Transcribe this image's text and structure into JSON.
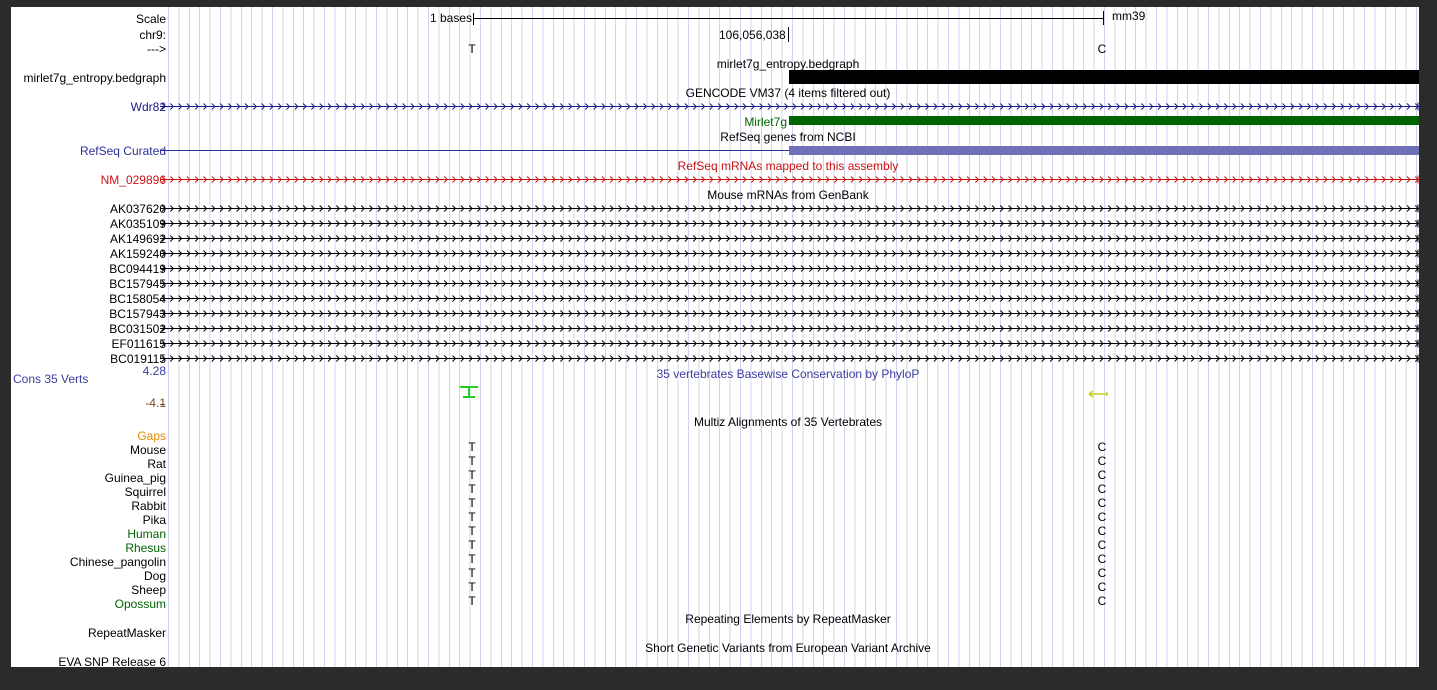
{
  "ruler": {
    "scale_label": "Scale",
    "chrom_label": "chr9:",
    "strand_label": "--->",
    "scale_text": "1 bases",
    "assembly": "mm39",
    "position": "106,056,038",
    "bases": [
      "T",
      "C"
    ]
  },
  "tracks": {
    "entropy": {
      "label": "mirlet7g_entropy.bedgraph",
      "title": "mirlet7g_entropy.bedgraph",
      "color": "#000000"
    },
    "gencode": {
      "title": "GENCODE VM37 (4 items filtered out)",
      "gene": "Wdr82",
      "gene2": "Mirlet7g",
      "color": "#1a1a8a",
      "gene2_color": "#006400"
    },
    "refseq": {
      "title": "RefSeq genes from NCBI",
      "label": "RefSeq Curated",
      "color": "#2e2e9a",
      "bar_color": "#7070b8"
    },
    "refseq_mrna": {
      "title": "RefSeq mRNAs mapped to this assembly",
      "label": "NM_029896",
      "color": "#cc1111"
    },
    "mouse_mrna": {
      "title": "Mouse mRNAs from GenBank",
      "items": [
        "AK037620",
        "AK035109",
        "AK149692",
        "AK159240",
        "BC094419",
        "BC157945",
        "BC158054",
        "BC157943",
        "BC031502",
        "EF011615",
        "BC019115"
      ]
    },
    "cons": {
      "title": "35 vertebrates Basewise Conservation by PhyloP",
      "label": "Cons 35 Verts",
      "max": "4.28",
      "min": "-4.1",
      "color": "#3c3ca0"
    },
    "multiz": {
      "title": "Multiz Alignments of 35 Vertebrates",
      "gaps_label": "Gaps",
      "species": [
        {
          "name": "Mouse",
          "color": "#000000"
        },
        {
          "name": "Rat",
          "color": "#000000"
        },
        {
          "name": "Guinea_pig",
          "color": "#000000"
        },
        {
          "name": "Squirrel",
          "color": "#000000"
        },
        {
          "name": "Rabbit",
          "color": "#000000"
        },
        {
          "name": "Pika",
          "color": "#000000"
        },
        {
          "name": "Human",
          "color": "#006400"
        },
        {
          "name": "Rhesus",
          "color": "#006400"
        },
        {
          "name": "Chinese_pangolin",
          "color": "#000000"
        },
        {
          "name": "Dog",
          "color": "#000000"
        },
        {
          "name": "Sheep",
          "color": "#000000"
        },
        {
          "name": "Opossum",
          "color": "#006400"
        }
      ]
    },
    "repeat": {
      "title": "Repeating Elements by RepeatMasker",
      "label": "RepeatMasker"
    },
    "eva": {
      "title": "Short Genetic Variants from European Variant Archive",
      "label": "EVA SNP Release 6"
    }
  }
}
